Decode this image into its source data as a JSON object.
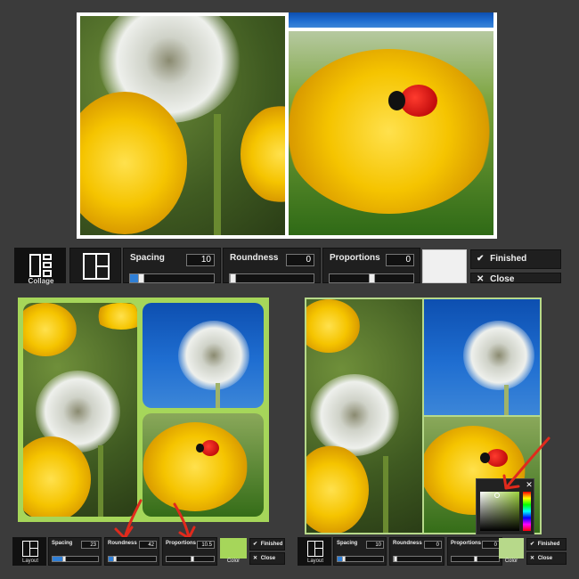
{
  "top_toolbar": {
    "layout_label": "Collage",
    "spacing": {
      "label": "Spacing",
      "value": "10",
      "level": 0.1
    },
    "roundness": {
      "label": "Roundness",
      "value": "0",
      "level": 0
    },
    "proportions": {
      "label": "Proportions",
      "value": "0",
      "level": 0.5
    },
    "color_value": "#f0f0f0",
    "finished_label": "Finished",
    "close_label": "Close"
  },
  "left_toolbar": {
    "layout_label": "Layout",
    "spacing": {
      "label": "Spacing",
      "value": "23",
      "level": 0.23
    },
    "roundness": {
      "label": "Roundness",
      "value": "42",
      "level": 0.1
    },
    "proportions": {
      "label": "Proportions",
      "value": "10.5",
      "level": 0.55
    },
    "color_label": "Color",
    "color_value": "#a6d65a",
    "finished_label": "Finished",
    "close_label": "Close"
  },
  "right_toolbar": {
    "layout_label": "Layout",
    "spacing": {
      "label": "Spacing",
      "value": "10",
      "level": 0.1
    },
    "roundness": {
      "label": "Roundness",
      "value": "0",
      "level": 0
    },
    "proportions": {
      "label": "Proportions",
      "value": "0",
      "level": 0.5
    },
    "color_label": "Color",
    "color_value": "#b7d98a",
    "finished_label": "Finished",
    "close_label": "Close"
  },
  "color_picker": {
    "close_icon": "close-icon"
  },
  "icons": {
    "check": "✔",
    "close": "✕"
  },
  "colors": {
    "accent_border": "#a6d65a",
    "slider_fill": "#2f7fd6",
    "arrow": "#e02a1c"
  }
}
